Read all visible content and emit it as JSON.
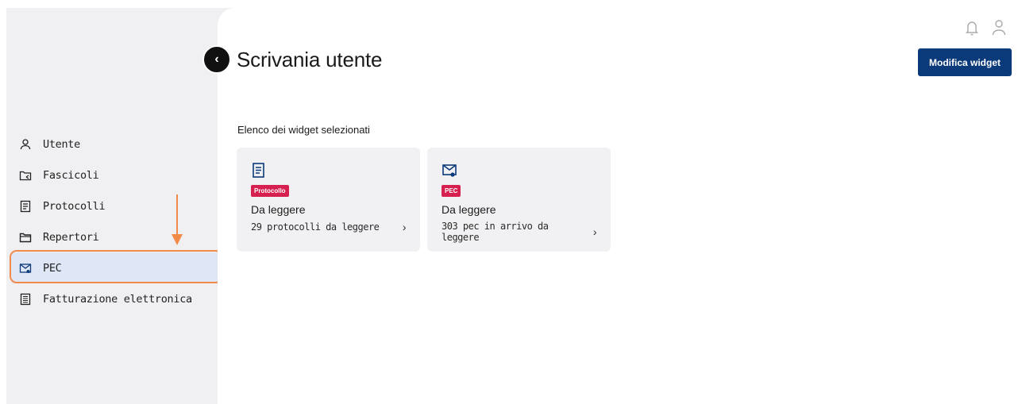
{
  "header": {
    "title": "Scrivania utente",
    "edit_button": "Modifica widget",
    "collapse_icon": "chevron-left-icon",
    "notification_icon": "bell-icon",
    "user_icon": "user-icon"
  },
  "sidebar": {
    "items": [
      {
        "label": "Utente",
        "icon": "user-icon",
        "active": false
      },
      {
        "label": "Fascicoli",
        "icon": "folder-share-icon",
        "active": false
      },
      {
        "label": "Protocolli",
        "icon": "document-icon",
        "active": false
      },
      {
        "label": "Repertori",
        "icon": "folder-icon",
        "active": false
      },
      {
        "label": "PEC",
        "icon": "certified-mail-icon",
        "active": true
      },
      {
        "label": "Fatturazione elettronica",
        "icon": "invoice-icon",
        "active": false
      }
    ]
  },
  "main": {
    "section_label": "Elenco dei widget selezionati",
    "widgets": [
      {
        "tag": "Protocollo",
        "title": "Da leggere",
        "subtitle": "29 protocolli da leggere",
        "chevron": "›",
        "icon": "document-icon"
      },
      {
        "tag": "PEC",
        "title": "Da leggere",
        "subtitle": "303 pec in arrivo da leggere",
        "chevron": "›",
        "icon": "certified-mail-icon"
      }
    ]
  },
  "colors": {
    "primary": "#0b3a7a",
    "tag": "#d6204f",
    "highlight": "#f28a4a",
    "active_bg": "#dfe7f6",
    "sidebar_bg": "#f0f0f2"
  }
}
